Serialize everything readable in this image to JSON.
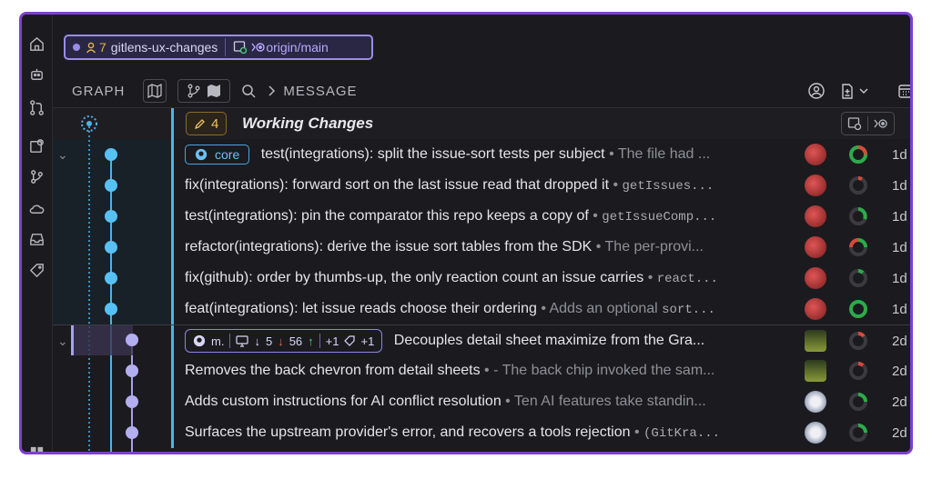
{
  "branch_bar": {
    "count": "7",
    "branch": "gitlens-ux-changes",
    "upstream": "origin/main"
  },
  "toolbar": {
    "graph_label": "GRAPH",
    "message_label": "MESSAGE"
  },
  "working_changes": {
    "count": "4",
    "label": "Working Changes"
  },
  "rows": [
    {
      "ref": "core",
      "message": "test(integrations): split the issue-sort tests per subject",
      "desc": "The file had ...",
      "desc_code": false,
      "age": "1d"
    },
    {
      "message": "fix(integrations): forward sort on the last issue read that dropped it",
      "desc": "getIssues...",
      "desc_code": true,
      "age": "1d"
    },
    {
      "message": "test(integrations): pin the comparator this repo keeps a copy of",
      "desc": "getIssueComp...",
      "desc_code": true,
      "age": "1d"
    },
    {
      "message": "refactor(integrations): derive the issue sort tables from the SDK",
      "desc": "The per-provi...",
      "desc_code": false,
      "age": "1d"
    },
    {
      "message": "fix(github): order by thumbs-up, the only reaction count an issue carries",
      "desc": "react...",
      "desc_code": true,
      "age": "1d"
    },
    {
      "message": "feat(integrations): let issue reads choose their ordering",
      "desc": "Adds an optional",
      "desc2": "sort...",
      "desc_code": false,
      "age": "1d"
    },
    {
      "ref2": {
        "name": "m.",
        "behind": "5",
        "ahead": "56",
        "plus1": "+1",
        "plus2": "+1"
      },
      "message": "Decouples detail sheet maximize from the Gra...",
      "desc": "",
      "age": "2d"
    },
    {
      "message": "Removes the back chevron from detail sheets",
      "desc": "- The back chip invoked the sam...",
      "desc_code": false,
      "age": "2d"
    },
    {
      "message": "Adds custom instructions for AI conflict resolution",
      "desc": "Ten AI features take standin...",
      "desc_code": false,
      "age": "2d"
    },
    {
      "message": "Surfaces the upstream provider's error, and recovers a tools rejection",
      "desc": "(GitKra...",
      "desc_code": true,
      "age": "2d"
    }
  ],
  "colors": {
    "accent": "#7e3fd1",
    "lane_blue": "#4fb3e8",
    "lane_purple": "#a7a3ea"
  }
}
